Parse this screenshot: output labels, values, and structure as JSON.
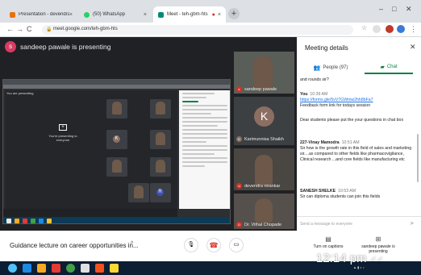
{
  "browser": {
    "tabs": [
      {
        "label": "Presentation - devendra nirankar - ...",
        "favicon_color": "#e8710a",
        "active": false
      },
      {
        "label": "(50) WhatsApp",
        "favicon_color": "#25d366",
        "active": false
      },
      {
        "label": "Meet - teh-gbm-hts",
        "favicon_color": "#00897b",
        "active": true
      }
    ],
    "new_tab": "+",
    "url": "meet.google.com/teh-gbm-hts"
  },
  "stage": {
    "presenter_initial": "s",
    "presenting_text": "sandeep pawale is presenting",
    "shared_screen": {
      "you_presenting": "You are presenting",
      "presenting_to_everyone": "You're presenting to everyone"
    }
  },
  "participants": [
    {
      "name": "sandeep pawale",
      "initial": "s"
    },
    {
      "name": "Karimunnisa Shaikh",
      "initial": "K",
      "avatar": "K"
    },
    {
      "name": "devendra nirankar",
      "initial": "d"
    },
    {
      "name": "Dr. Vithal Chopade",
      "initial": "D"
    }
  ],
  "panel": {
    "title": "Meeting details",
    "close_icon": "close-icon",
    "tabs": [
      {
        "label": "People (97)",
        "icon": "people-icon",
        "active": false
      },
      {
        "label": "Chat",
        "icon": "chat-icon",
        "active": true
      }
    ],
    "messages": [
      {
        "sender": "",
        "time": "",
        "text": "and rounds sir?"
      },
      {
        "sender": "You",
        "time": "10:39 AM",
        "link": "https://forms.gle/5vV7GWmw2hh8bFa7",
        "text": "Feedback form link for todays session"
      },
      {
        "sender": "",
        "time": "",
        "text": "Dear students please put the your questions in chat box"
      },
      {
        "sender": "227-Vinay Mamodra",
        "time": "10:51 AM",
        "text": "Sir how is the growth rate in this field of sales and marketing sir....as compared to other fields like pharmacovigilance, Clinical research ...and core fields like manufacturing etc"
      },
      {
        "sender": "SANESH SHELKE",
        "time": "10:53 AM",
        "text": "Sir can diploma students can join this fields"
      }
    ],
    "compose_placeholder": "Send a message to everyone"
  },
  "bottom_bar": {
    "meeting_title": "Guidance lecture on career opportunities in...",
    "captions_label": "Turn on captions",
    "present_label": "sandeep pawale is presenting",
    "controls": {
      "mic": "mic-icon",
      "hangup": "hangup-icon",
      "camera": "camera-icon"
    }
  },
  "overlay": {
    "clock": "12:14 pm"
  },
  "colors": {
    "meet_dark": "#202124",
    "chat_green": "#0b8043",
    "hangup_red": "#d93025",
    "link_blue": "#1a73e8",
    "taskbar": "#0b1e33"
  }
}
